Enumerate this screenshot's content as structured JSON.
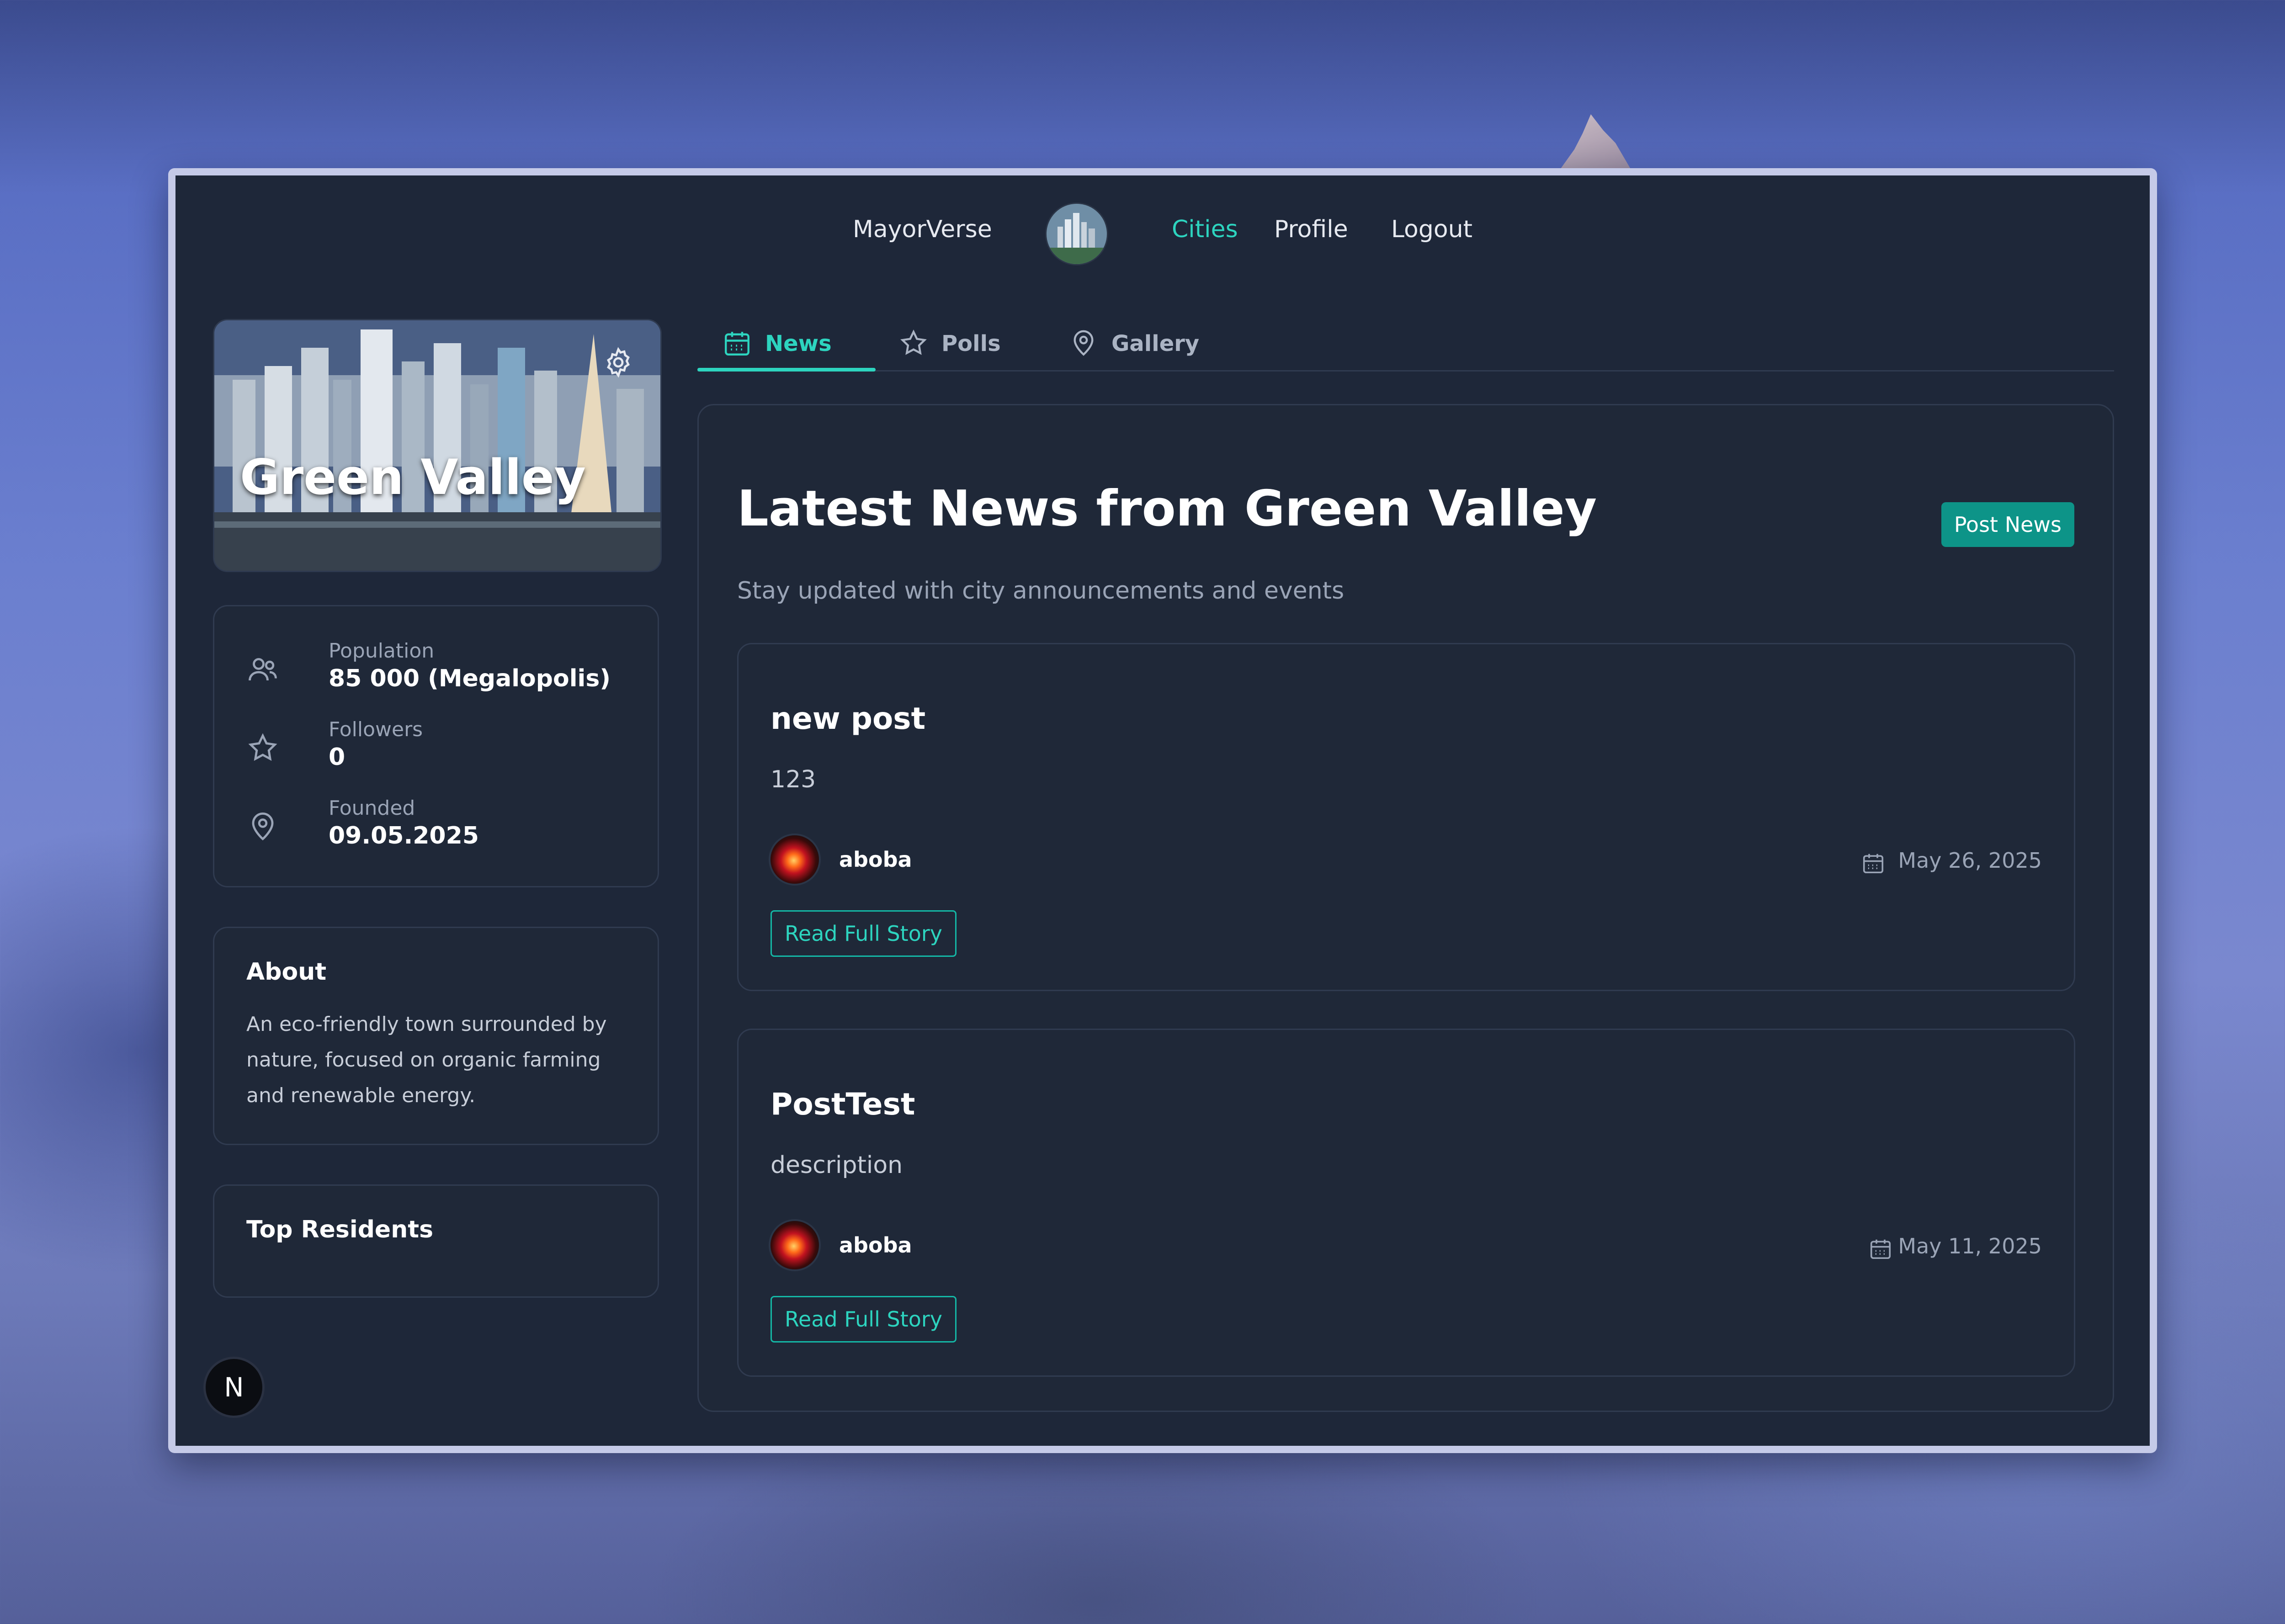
{
  "nav": {
    "brand": "MayorVerse",
    "links": [
      "Cities",
      "Profile",
      "Logout"
    ],
    "active": "Cities",
    "accent_color": "#2dd4bf"
  },
  "city": {
    "name": "Green Valley",
    "stats": [
      {
        "label": "Population",
        "value": "85 000 (Megalopolis)",
        "icon": "users-icon"
      },
      {
        "label": "Followers",
        "value": "0",
        "icon": "star-icon"
      },
      {
        "label": "Founded",
        "value": "09.05.2025",
        "icon": "map-pin-icon"
      }
    ],
    "about_title": "About",
    "about_text": "An eco-friendly town surrounded by nature, focused on organic farming and renewable energy.",
    "top_residents_title": "Top Residents"
  },
  "tabs": [
    {
      "label": "News",
      "icon": "calendar-icon"
    },
    {
      "label": "Polls",
      "icon": "star-icon"
    },
    {
      "label": "Gallery",
      "icon": "map-pin-icon"
    }
  ],
  "news": {
    "title": "Latest News from Green Valley",
    "subtitle": "Stay updated with city announcements and events",
    "post_button": "Post News",
    "posts": [
      {
        "title": "new post",
        "description": "123",
        "author": "aboba",
        "date": "May 26, 2025",
        "read_label": "Read Full Story"
      },
      {
        "title": "PostTest",
        "description": "description",
        "author": "aboba",
        "date": "May 11, 2025",
        "read_label": "Read Full Story"
      }
    ]
  },
  "badge": "N"
}
